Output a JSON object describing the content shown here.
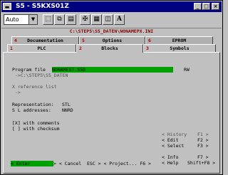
{
  "window": {
    "title": "S5 - S5KXS01Z"
  },
  "toolbar": {
    "zoom_value": "Auto",
    "letter_button": "A"
  },
  "path": "C:\\STEP5\\S5_DATEN\\NONAMEPX.INI",
  "tabs_back": [
    {
      "num": "4",
      "label": "Documentation"
    },
    {
      "num": "5",
      "label": "Options"
    },
    {
      "num": "6",
      "label": "EPROM"
    }
  ],
  "tabs_front": [
    {
      "num": "1",
      "label": "PLC"
    },
    {
      "num": "2",
      "label": "Blocks"
    },
    {
      "num": "3",
      "label": "Symbols"
    }
  ],
  "form": {
    "program_file_label": "Program file",
    "program_file_value": "NONAMEST.S5D",
    "rw": "RW",
    "program_file_dir": "->C:\\STEP5\\S5_DATEN",
    "reference_list_label": "X reference list",
    "reference_list_arrow": "->",
    "representation_label": "Representation:",
    "representation_value": "STL",
    "sl_addresses_label": "S L addresses:",
    "sl_addresses_value": "NNRD",
    "with_comments": "[X] with comments",
    "with_checksum": "[ ] with checksum"
  },
  "menu": [
    {
      "label": "< History",
      "key": "F1 >"
    },
    {
      "label": "< Edit",
      "key": "F2 >"
    },
    {
      "label": "< Select",
      "key": "F3 >"
    },
    {
      "label": "< Info",
      "key": "F7 >"
    },
    {
      "label": "< Help",
      "key": "Shift+F8 >"
    }
  ],
  "bottom": {
    "enter": "< Enter",
    "cancel": "> < Cancel  ESC > < Project... F6 >"
  }
}
